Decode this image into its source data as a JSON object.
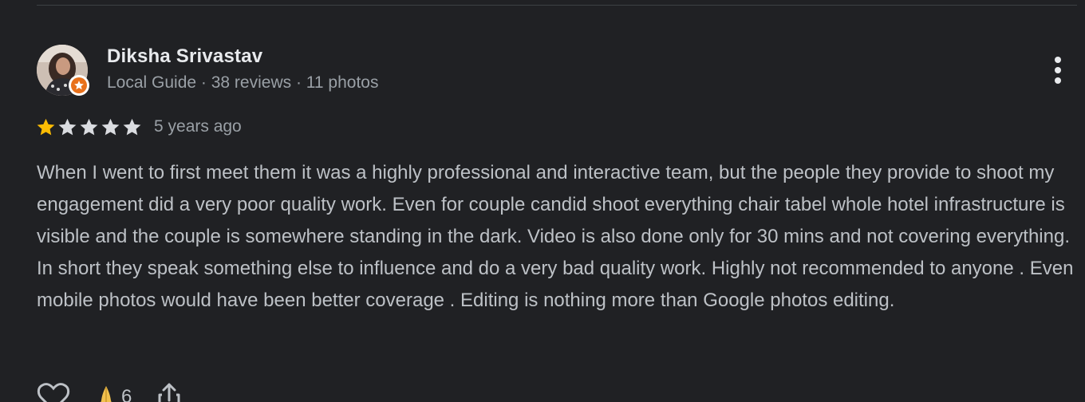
{
  "reviewer": {
    "name": "Diksha Srivastav",
    "meta": "Local Guide · 38 reviews · 11 photos"
  },
  "review": {
    "rating": 1,
    "max_rating": 5,
    "date": "5 years ago",
    "text": "When I went to first meet them it was a highly professional and interactive team, but the people they provide to shoot my engagement did a very poor quality work. Even for couple candid shoot everything chair tabel whole hotel infrastructure is visible and the couple is somewhere standing in the dark. Video is also done only for 30 mins and not covering everything. In short they speak something else to influence and do a very bad quality work. Highly not recommended to anyone . Even mobile photos would have been better coverage . Editing is nothing more than Google photos editing."
  },
  "actions": {
    "reaction_count": "6"
  },
  "icons": {
    "more": "more-vert-icon",
    "star": "star-icon",
    "like": "heart-icon",
    "reaction": "folded-hands-icon",
    "share": "share-icon",
    "badge": "local-guide-star-icon"
  },
  "colors": {
    "background": "#202124",
    "star_filled": "#fbbc04",
    "star_empty": "#dadce0",
    "local_guide_badge": "#e8711c"
  }
}
